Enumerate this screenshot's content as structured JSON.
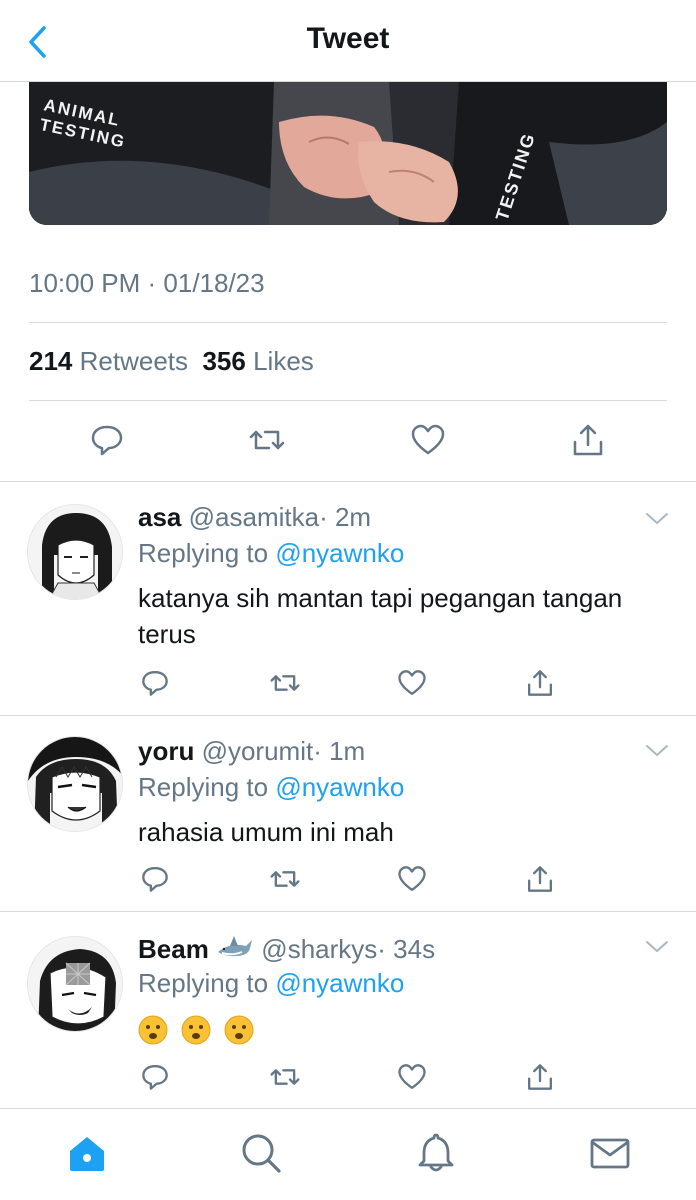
{
  "header": {
    "title": "Tweet"
  },
  "tweet": {
    "image_text": [
      "ANIMAL",
      "TESTING",
      "TESTING"
    ],
    "timestamp": "10:00 PM · 01/18/23",
    "retweets_count": "214",
    "retweets_label": "Retweets",
    "likes_count": "356",
    "likes_label": "Likes"
  },
  "replies": [
    {
      "name": "asa",
      "handle": "@asamitka",
      "time": "· 2m",
      "replying_prefix": "Replying to",
      "mention": "@nyawnko",
      "text": "katanya sih mantan tapi pegangan tangan terus"
    },
    {
      "name": "yoru",
      "handle": "@yorumit",
      "time": "· 1m",
      "replying_prefix": "Replying to",
      "mention": "@nyawnko",
      "text": "rahasia umum ini mah"
    },
    {
      "name": "Beam",
      "handle": "@sharkys",
      "time": "· 34s",
      "replying_prefix": "Replying to",
      "mention": "@nyawnko",
      "emoji_name": "frowning-face-emoji"
    }
  ],
  "icons": {
    "back": "chevron-left-icon",
    "reply": "speech-bubble-icon",
    "retweet": "retweet-icon",
    "like": "heart-icon",
    "share": "share-icon",
    "more": "chevron-down-icon",
    "tab_home": "home-icon",
    "tab_search": "search-icon",
    "tab_notifications": "bell-icon",
    "tab_messages": "mail-icon"
  },
  "colors": {
    "accent": "#1da1f2",
    "muted": "#657786",
    "text": "#14171a",
    "divider": "#d7dbdf"
  }
}
